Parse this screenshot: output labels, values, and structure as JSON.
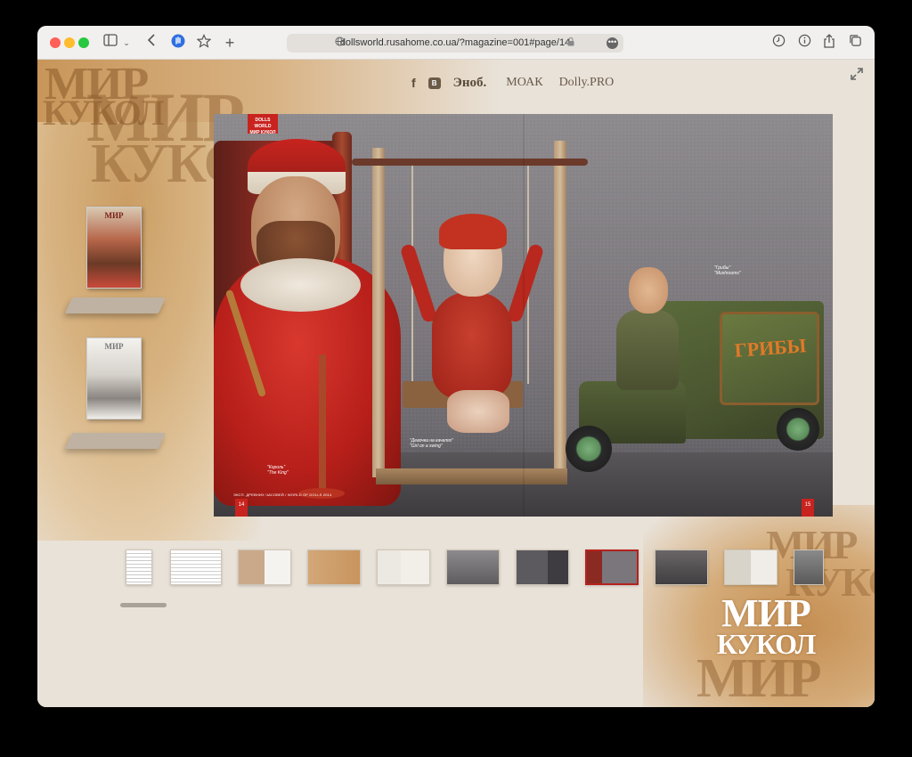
{
  "browser": {
    "url": "dollsworld.rusahome.co.ua/?magazine=001#page/14",
    "icons": [
      "sidebar-icon",
      "chevron-down-icon",
      "back-icon",
      "hand-icon",
      "star-icon",
      "plus-icon",
      "globe-icon",
      "lock-icon",
      "more-icon",
      "clock-icon",
      "info-icon",
      "share-icon",
      "tabs-icon"
    ]
  },
  "site": {
    "bg_word_1": "МИР",
    "bg_word_2": "КУКОЛ",
    "nav": {
      "facebook": "f",
      "vk": "В",
      "snob": "Эноб.",
      "moak": "МОАК",
      "dolly": "Dolly.PRO"
    },
    "covers": [
      {
        "label": "МИР"
      },
      {
        "label": "МИР"
      }
    ],
    "brand_logo": {
      "line1": "МИР",
      "line2": "КУКОЛ"
    }
  },
  "spread": {
    "badge": "DOLLS WORLD\nМИР КУКОЛ",
    "page_left": "14",
    "page_right": "15",
    "captions": {
      "king": "\"Король\"\n\"The King\"",
      "girl": "\"Девочка на качелях\"\n\"Girl on a swing\"",
      "truck": "\"Грибы\"\n\"Mushrooms\""
    },
    "truck_text": "ГРИБЫ",
    "footer": "ЭКСП. ДРЕВНИХ ЧАСОВЕЙ / WORLD OF DOLLS 2014"
  },
  "thumbnails": {
    "count": 12,
    "active_index": 7
  },
  "colors": {
    "accent_red": "#c8231e",
    "paper": "#d6b07c",
    "page_bg": "#e9e2d8"
  }
}
